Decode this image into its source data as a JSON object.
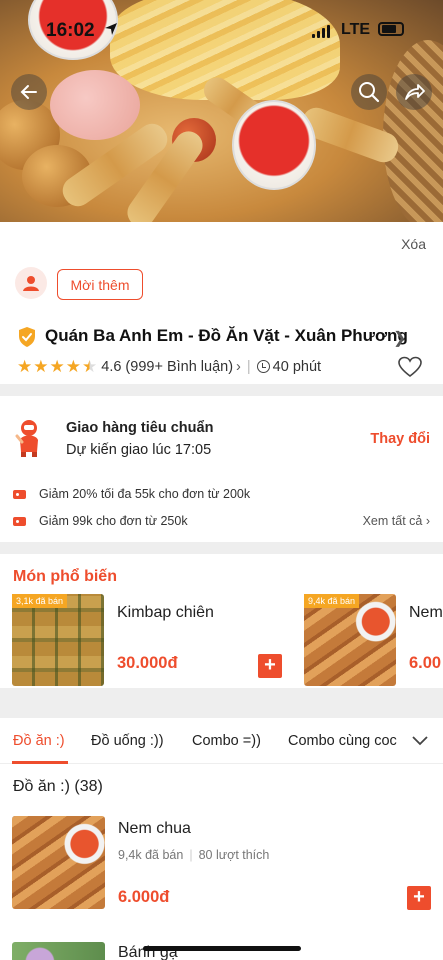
{
  "status_bar": {
    "time": "16:02",
    "network": "LTE"
  },
  "hero": {
    "back_icon": "back-arrow-icon",
    "search_icon": "search-icon",
    "share_icon": "share-icon"
  },
  "actions": {
    "delete_label": "Xóa",
    "invite_label": "Mời thêm"
  },
  "shop": {
    "name": "Quán Ba Anh Em - Đồ Ăn Vặt - Xuân Phương",
    "rating": "4.6",
    "reviews": "(999+ Bình luận)",
    "stars": 4.5,
    "delivery_time": "40 phút"
  },
  "delivery": {
    "title": "Giao hàng tiêu chuẩn",
    "eta": "Dự kiến giao lúc 17:05",
    "change_label": "Thay đổi",
    "vouchers": [
      "Giảm 20% tối đa 55k cho đơn từ 200k",
      "Giảm 99k cho đơn từ 250k"
    ],
    "see_all": "Xem tất cả"
  },
  "popular": {
    "heading": "Món phổ biến",
    "items": [
      {
        "sold": "3,1k đã bán",
        "name": "Kimbap chiên",
        "price": "30.000đ"
      },
      {
        "sold": "9,4k đã bán",
        "name": "Nem",
        "price": "6.00"
      }
    ]
  },
  "tabs": [
    "Đồ ăn :)",
    "Đồ uống :))",
    "Combo =))",
    "Combo cùng coc"
  ],
  "menu": {
    "category": "Đồ ăn :) (38)",
    "items": [
      {
        "name": "Nem chua",
        "sold": "9,4k đã bán",
        "likes": "80 lượt thích",
        "price": "6.000đ"
      },
      {
        "name": "Bánh gạ"
      }
    ]
  },
  "colors": {
    "accent": "#ee4d2d",
    "star": "#f5a623"
  }
}
